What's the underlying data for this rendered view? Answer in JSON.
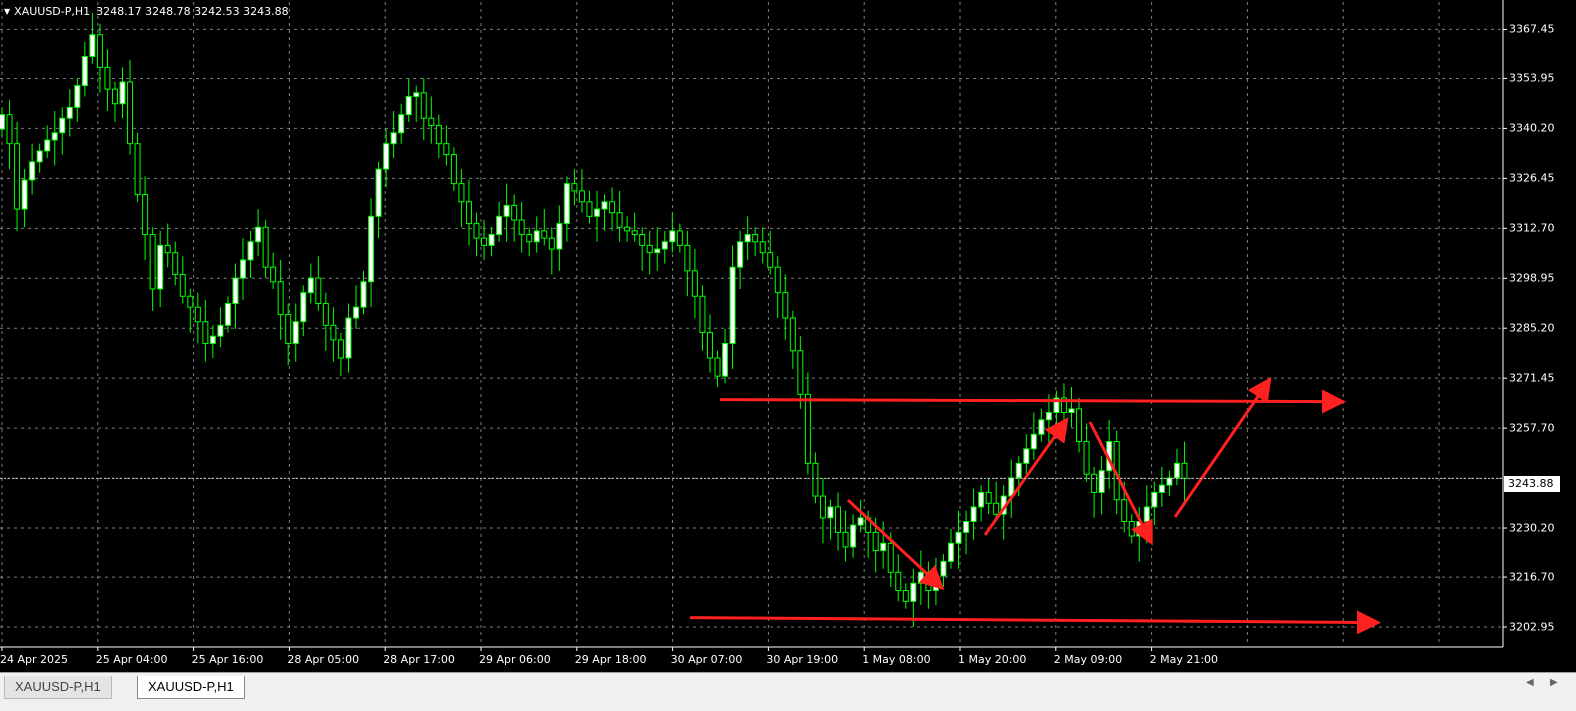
{
  "header": {
    "symbol": "XAUUSD-P,H1",
    "ohlc": "3248.17 3248.78 3242.53 3243.88"
  },
  "price_axis": {
    "ticks": [
      "3367.45",
      "3353.95",
      "3340.20",
      "3326.45",
      "3312.70",
      "3298.95",
      "3285.20",
      "3271.45",
      "3257.70",
      "3243.88",
      "3230.20",
      "3216.70",
      "3202.95"
    ],
    "current_price": "3243.88"
  },
  "time_axis": {
    "ticks": [
      "24 Apr 2025",
      "25 Apr 04:00",
      "25 Apr 16:00",
      "28 Apr 05:00",
      "28 Apr 17:00",
      "29 Apr 06:00",
      "29 Apr 18:00",
      "30 Apr 07:00",
      "30 Apr 19:00",
      "1 May 08:00",
      "1 May 20:00",
      "2 May 09:00",
      "2 May 21:00"
    ]
  },
  "tabs": [
    {
      "label": "XAUUSD-P,H1",
      "active": false
    },
    {
      "label": "XAUUSD-P,H1",
      "active": true
    }
  ],
  "colors": {
    "background": "#000000",
    "grid": "#c0c0c0",
    "candle_bull": "#ffffff",
    "candle_outline": "#00ff00",
    "annotation": "#ff2020"
  },
  "chart_data": {
    "type": "candlestick",
    "symbol": "XAUUSD-P",
    "timeframe": "H1",
    "ylim": [
      3198,
      3375
    ],
    "closes": [
      3344,
      3336,
      3318,
      3326,
      3331,
      3334,
      3337,
      3339,
      3343,
      3346,
      3352,
      3360,
      3366,
      3357,
      3351,
      3347,
      3353,
      3336,
      3322,
      3311,
      3296,
      3308,
      3306,
      3300,
      3294,
      3291,
      3287,
      3281,
      3283,
      3286,
      3292,
      3299,
      3304,
      3309,
      3313,
      3302,
      3298,
      3289,
      3281,
      3287,
      3295,
      3299,
      3292,
      3286,
      3282,
      3277,
      3288,
      3291,
      3298,
      3316,
      3329,
      3336,
      3339,
      3344,
      3349,
      3350,
      3343,
      3341,
      3336,
      3333,
      3325,
      3320,
      3314,
      3310,
      3308,
      3311,
      3316,
      3319,
      3315,
      3311,
      3309,
      3312,
      3310,
      3307,
      3314,
      3325,
      3323,
      3320,
      3316,
      3318,
      3320,
      3317,
      3313,
      3312,
      3311,
      3308,
      3306,
      3307,
      3309,
      3312,
      3308,
      3301,
      3294,
      3284,
      3277,
      3272,
      3281,
      3302,
      3309,
      3311,
      3309,
      3306,
      3302,
      3295,
      3288,
      3279,
      3267,
      3248,
      3239,
      3233,
      3236,
      3229,
      3225,
      3231,
      3233,
      3229,
      3224,
      3226,
      3218,
      3213,
      3210,
      3215,
      3218,
      3213,
      3217,
      3221,
      3226,
      3229,
      3232,
      3236,
      3240,
      3237,
      3234,
      3239,
      3244,
      3248,
      3252,
      3256,
      3260,
      3262,
      3266,
      3262,
      3263,
      3254,
      3245,
      3240,
      3246,
      3254,
      3238,
      3232,
      3228,
      3232,
      3236,
      3240,
      3242,
      3244,
      3248,
      3243.88
    ]
  },
  "annotations": {
    "type": "hand-drawn trend arrows",
    "resistance_level": 3265,
    "support_level": 3205
  }
}
